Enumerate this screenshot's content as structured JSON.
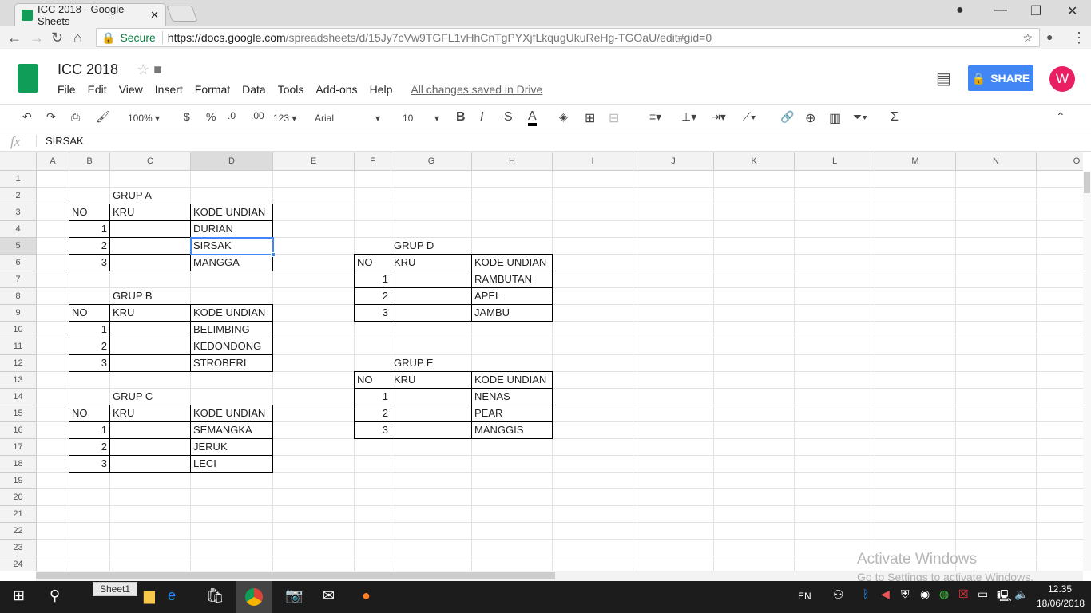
{
  "browser": {
    "tab_title": "ICC 2018 - Google Sheets",
    "secure_label": "Secure",
    "url_host": "https://docs.google.com",
    "url_path": "/spreadsheets/d/15Jy7cVw9TGFL1vHhCnTgPYXjfLkqugUkuReHg-TGOaU/edit#gid=0"
  },
  "doc": {
    "title": "ICC 2018",
    "menus": [
      "File",
      "Edit",
      "View",
      "Insert",
      "Format",
      "Data",
      "Tools",
      "Add-ons",
      "Help"
    ],
    "save_status": "All changes saved in Drive",
    "share_label": "SHARE",
    "avatar_letter": "W",
    "accent": "#4285f4"
  },
  "toolbar": {
    "zoom": "100%",
    "currency": "$",
    "percent": "%",
    "dec_less": ".0",
    "dec_more": ".00",
    "format": "123",
    "font": "Arial",
    "font_size": "10"
  },
  "formula_bar": {
    "fx": "fx",
    "value": "SIRSAK"
  },
  "columns": [
    "A",
    "B",
    "C",
    "D",
    "E",
    "F",
    "G",
    "H",
    "I",
    "J",
    "K",
    "L",
    "M",
    "N",
    "O"
  ],
  "rows": 24,
  "selected_cell": "D5",
  "tables": [
    {
      "title": "GRUP A",
      "origin": "B2",
      "headers": [
        "NO",
        "KRU",
        "KODE UNDIAN"
      ],
      "rows": [
        [
          "1",
          "",
          "DURIAN"
        ],
        [
          "2",
          "",
          "SIRSAK"
        ],
        [
          "3",
          "",
          "MANGGA"
        ]
      ]
    },
    {
      "title": "GRUP B",
      "origin": "B8",
      "headers": [
        "NO",
        "KRU",
        "KODE UNDIAN"
      ],
      "rows": [
        [
          "1",
          "",
          "BELIMBING"
        ],
        [
          "2",
          "",
          "KEDONDONG"
        ],
        [
          "3",
          "",
          "STROBERI"
        ]
      ]
    },
    {
      "title": "GRUP C",
      "origin": "B14",
      "headers": [
        "NO",
        "KRU",
        "KODE UNDIAN"
      ],
      "rows": [
        [
          "1",
          "",
          "SEMANGKA"
        ],
        [
          "2",
          "",
          "JERUK"
        ],
        [
          "3",
          "",
          "LECI"
        ]
      ]
    },
    {
      "title": "GRUP D",
      "origin": "F5",
      "headers": [
        "NO",
        "KRU",
        "KODE UNDIAN"
      ],
      "rows": [
        [
          "1",
          "",
          "RAMBUTAN"
        ],
        [
          "2",
          "",
          "APEL"
        ],
        [
          "3",
          "",
          "JAMBU"
        ]
      ]
    },
    {
      "title": "GRUP E",
      "origin": "F12",
      "headers": [
        "NO",
        "KRU",
        "KODE UNDIAN"
      ],
      "rows": [
        [
          "1",
          "",
          "NENAS"
        ],
        [
          "2",
          "",
          "PEAR"
        ],
        [
          "3",
          "",
          "MANGGIS"
        ]
      ]
    }
  ],
  "sheet_tab": "Sheet1",
  "watermark": {
    "line1": "Activate Windows",
    "line2": "Go to Settings to activate Windows."
  },
  "taskbar": {
    "lang": "EN",
    "time": "12.35",
    "date": "18/06/2018"
  }
}
